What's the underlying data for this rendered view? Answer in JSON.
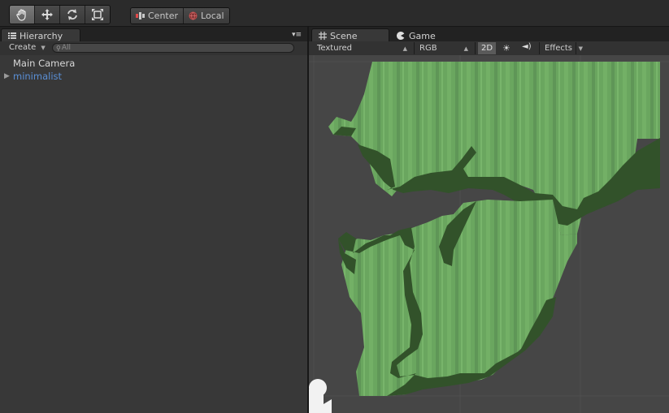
{
  "toolbar": {
    "tools": [
      {
        "name": "hand-tool-button",
        "icon": "hand-icon",
        "active": true
      },
      {
        "name": "move-tool-button",
        "icon": "move-icon",
        "active": false
      },
      {
        "name": "rotate-tool-button",
        "icon": "rotate-icon",
        "active": false
      },
      {
        "name": "scale-tool-button",
        "icon": "scale-icon",
        "active": false
      }
    ],
    "pivot_label": "Center",
    "space_label": "Local"
  },
  "hierarchy": {
    "tab_label": "Hierarchy",
    "create_label": "Create",
    "search_placeholder": "All",
    "items": [
      {
        "label": "Main Camera"
      },
      {
        "label": "minimalist"
      }
    ],
    "selected_color": "#5a8fd6"
  },
  "scene": {
    "tabs": [
      {
        "label": "Scene"
      },
      {
        "label": "Game"
      }
    ],
    "render_mode": "Textured",
    "color_mode": "RGB",
    "mode_2d": "2D",
    "effects_label": "Effects"
  },
  "colors": {
    "light_green": "#6aa65f",
    "dark_green": "#32522a",
    "grid_bg": "#464646"
  }
}
